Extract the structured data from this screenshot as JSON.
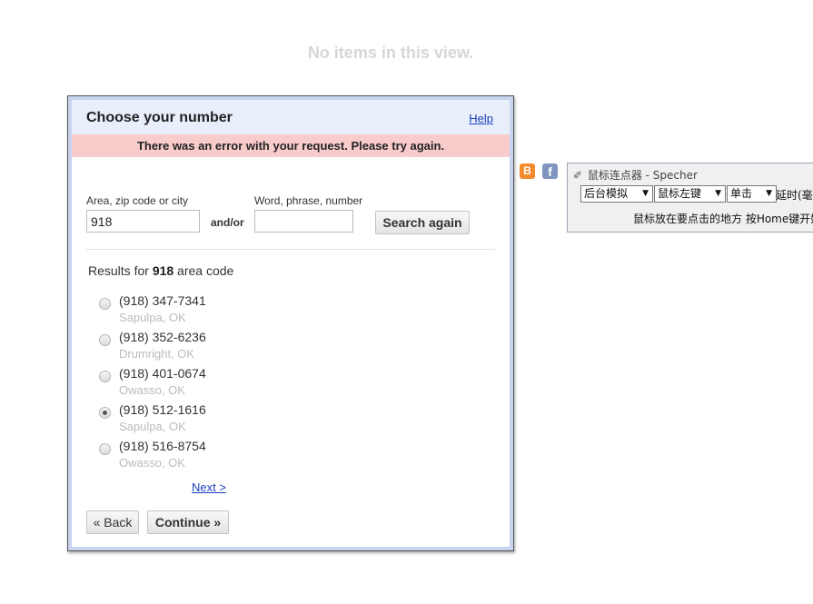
{
  "view": {
    "empty_message": "No items in this view."
  },
  "dialog": {
    "title": "Choose your number",
    "help_label": "Help",
    "error_message": "There was an error with your request. Please try again.",
    "area_label": "Area, zip code or city",
    "area_value": "918",
    "andor_label": "and/or",
    "word_label": "Word, phrase, number",
    "word_value": "",
    "search_button": "Search again",
    "results_prefix": "Results for ",
    "results_code": "918",
    "results_suffix": " area code",
    "results": [
      {
        "number": "(918) 347-7341",
        "city": "Sapulpa, OK",
        "selected": false
      },
      {
        "number": "(918) 352-6236",
        "city": "Drumright, OK",
        "selected": false
      },
      {
        "number": "(918) 401-0674",
        "city": "Owasso, OK",
        "selected": false
      },
      {
        "number": "(918) 512-1616",
        "city": "Sapulpa, OK",
        "selected": true
      },
      {
        "number": "(918) 516-8754",
        "city": "Owasso, OK",
        "selected": false
      }
    ],
    "next_label": "Next >",
    "back_button": "« Back",
    "continue_button": "Continue »"
  },
  "social": {
    "blogger_icon": "blogger-icon",
    "facebook_icon": "facebook-icon",
    "blogger_glyph": "B",
    "facebook_glyph": "f"
  },
  "tool_window": {
    "title": "鼠标连点器 - Specher",
    "mode_select": "后台模拟",
    "button_select": "鼠标左键",
    "click_select": "单击",
    "delay_label": "延时(毫",
    "hint_text": "鼠标放在要点击的地方 按Home键开始"
  }
}
